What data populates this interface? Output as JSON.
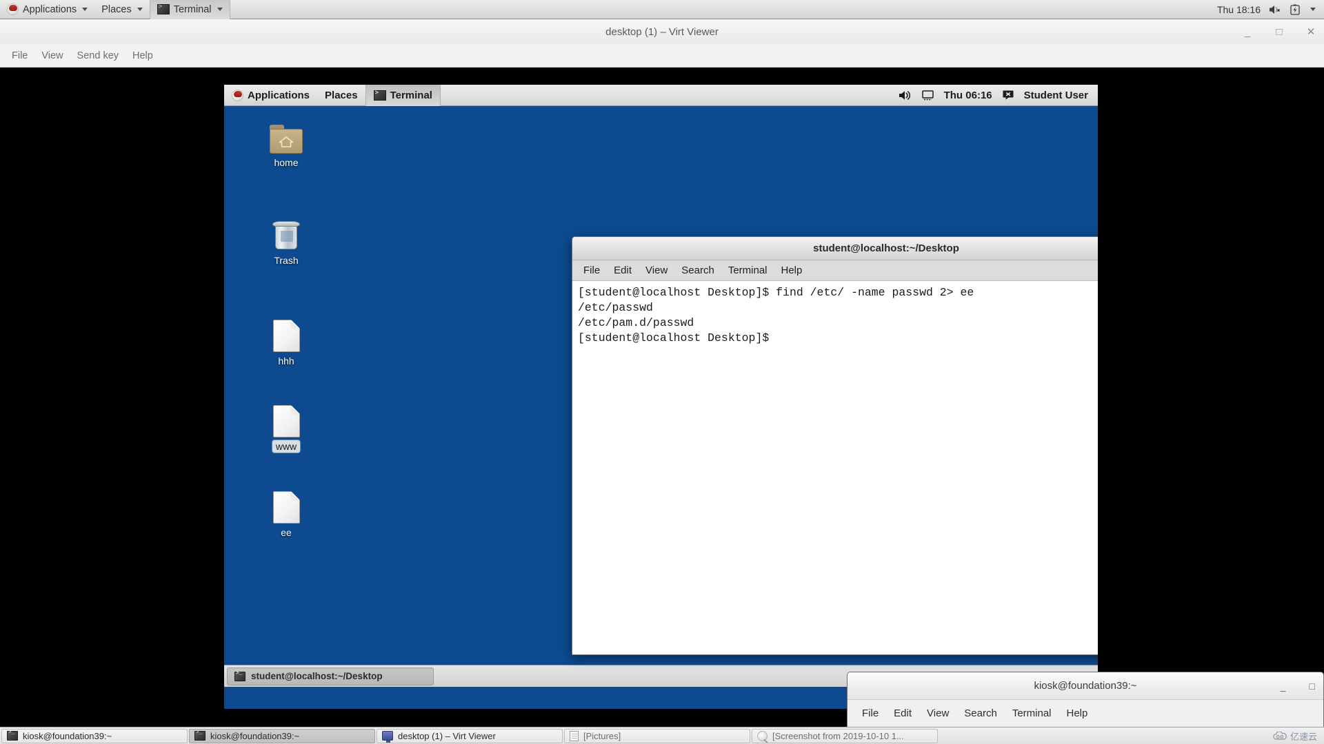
{
  "host": {
    "top_panel": {
      "logo": "fedora-logo",
      "menus": [
        {
          "label": "Applications",
          "has_caret": true,
          "active": false
        },
        {
          "label": "Places",
          "has_caret": true,
          "active": false
        },
        {
          "label": "Terminal",
          "has_caret": true,
          "active": true
        }
      ],
      "clock": "Thu 18:16",
      "icons": [
        "volume-muted-icon",
        "battery-charging-icon",
        "chevron-down-icon"
      ]
    },
    "virt_viewer": {
      "title": "desktop (1) – Virt Viewer",
      "window_buttons": {
        "minimize": "_",
        "maximize": "□",
        "close": "✕"
      },
      "menu": [
        "File",
        "View",
        "Send key",
        "Help"
      ]
    },
    "kiosk_terminal": {
      "title": "kiosk@foundation39:~",
      "menu": [
        "File",
        "Edit",
        "View",
        "Search",
        "Terminal",
        "Help"
      ],
      "window_buttons": {
        "minimize": "_",
        "maximize": "□"
      }
    },
    "taskbar": {
      "items": [
        {
          "label": "kiosk@foundation39:~",
          "icon": "terminal-icon",
          "active": false,
          "dim": false
        },
        {
          "label": "kiosk@foundation39:~",
          "icon": "terminal-icon",
          "active": true,
          "dim": false
        },
        {
          "label": "desktop (1) – Virt Viewer",
          "icon": "monitor-icon",
          "active": false,
          "dim": false
        },
        {
          "label": "[Pictures]",
          "icon": "document-icon",
          "active": false,
          "dim": true
        },
        {
          "label": "[Screenshot from 2019-10-10 1...",
          "icon": "image-icon",
          "active": false,
          "dim": true
        }
      ],
      "watermark": "亿速云"
    }
  },
  "guest": {
    "top_panel": {
      "logo": "fedora-logo",
      "menus": [
        {
          "label": "Applications",
          "active": false
        },
        {
          "label": "Places",
          "active": false
        },
        {
          "label": "Terminal",
          "active": true
        }
      ],
      "clock": "Thu 06:16",
      "user": "Student User",
      "icons": [
        "volume-icon",
        "display-icon",
        "message-icon"
      ]
    },
    "desktop_icons": [
      {
        "label": "home",
        "type": "folder",
        "selected": false
      },
      {
        "label": "Trash",
        "type": "trash",
        "selected": false
      },
      {
        "label": "hhh",
        "type": "file",
        "selected": false
      },
      {
        "label": "www",
        "type": "file",
        "selected": true
      },
      {
        "label": "ee",
        "type": "file",
        "selected": false
      }
    ],
    "terminal": {
      "title": "student@localhost:~/Desktop",
      "menu": [
        "File",
        "Edit",
        "View",
        "Search",
        "Terminal",
        "Help"
      ],
      "window_buttons": {
        "minimize": "_",
        "maximize": "□",
        "close": "✕"
      },
      "content": "[student@localhost Desktop]$ find /etc/ -name passwd 2> ee\n/etc/passwd\n/etc/pam.d/passwd\n[student@localhost Desktop]$ ",
      "scroll_thumb": {
        "top_pct": 42,
        "height_pct": 58
      }
    },
    "taskbar": {
      "items": [
        {
          "label": "student@localhost:~/Desktop",
          "icon": "terminal-icon"
        }
      ]
    }
  },
  "colors": {
    "desktop_blue": "#0d4a8f",
    "panel_gray": "#e2e2e2",
    "terminal_bg": "#ffffff",
    "terminal_fg": "#1b1b1b"
  }
}
